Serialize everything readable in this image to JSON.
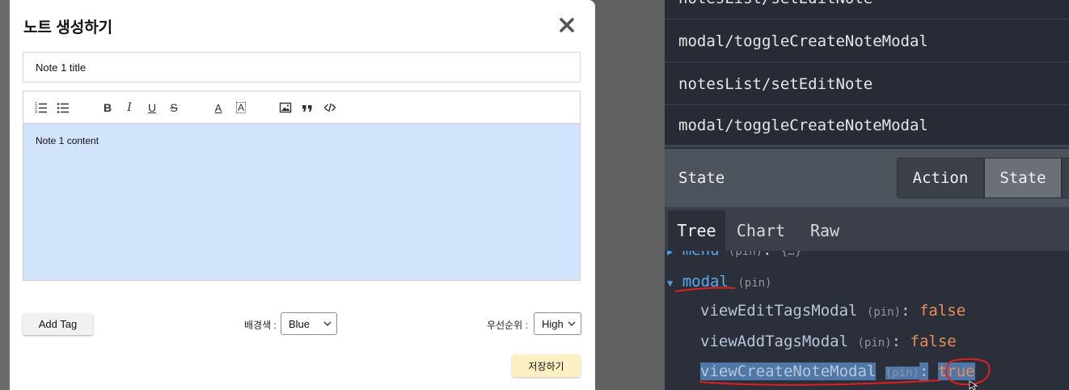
{
  "modal": {
    "title": "노트 생성하기",
    "title_input_value": "Note 1 title",
    "editor_content": "Note 1 content",
    "toolbar_icons": [
      "ordered-list-icon",
      "bullet-list-icon",
      "bold-icon",
      "italic-icon",
      "underline-icon",
      "strikethrough-icon",
      "font-color-icon",
      "highlight-icon",
      "image-icon",
      "quote-icon",
      "code-icon"
    ],
    "toolbar_glyphs": {
      "bold": "B",
      "italic": "I",
      "underline": "U",
      "strike": "S",
      "font_color": "A",
      "highlight": "A"
    },
    "add_tag_label": "Add Tag",
    "bg_color_label": "배경색 :",
    "bg_color_value": "Blue",
    "priority_label": "우선순위 :",
    "priority_value": "High",
    "save_label": "저장하기",
    "colors": {
      "editor_bg": "#d2e3fc",
      "save_bg": "#fdf0c2"
    }
  },
  "devtools": {
    "actions": [
      "notesList/setEditNote",
      "modal/toggleCreateNoteModal",
      "notesList/setEditNote",
      "modal/toggleCreateNoteModal"
    ],
    "header_title": "State",
    "segments": {
      "action": "Action",
      "state": "State"
    },
    "tabs": {
      "tree": "Tree",
      "chart": "Chart",
      "raw": "Raw"
    },
    "tree": {
      "menu_key": "menu",
      "menu_value": "{…}",
      "modal_key": "modal",
      "pin": "(pin)",
      "colon": ":",
      "items": [
        {
          "key": "viewEditTagsModal",
          "value": "false"
        },
        {
          "key": "viewAddTagsModal",
          "value": "false"
        },
        {
          "key": "viewCreateNoteModal",
          "value": "true"
        }
      ]
    },
    "colors": {
      "panel_bg": "#2a2f3a",
      "value_color": "#e88d5a",
      "key_top": "#5aa9f0",
      "annotation": "#e0201e"
    }
  }
}
